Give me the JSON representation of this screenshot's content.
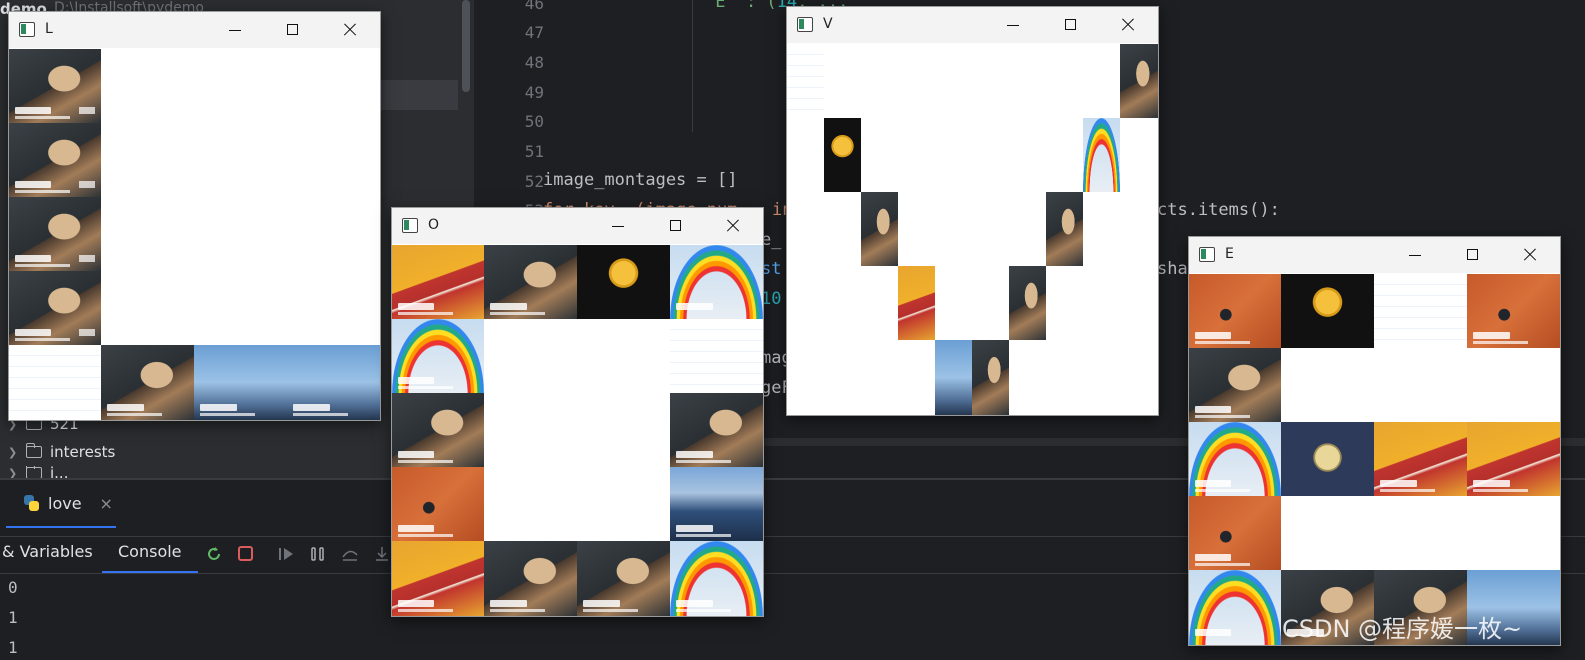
{
  "ide": {
    "project_title": "demo",
    "project_path": "D:\\Installsoft\\pydemo",
    "tree": [
      {
        "label": "521"
      },
      {
        "label": "interests"
      },
      {
        "label": "i..."
      }
    ],
    "line_numbers": [
      "46",
      "47",
      "48",
      "49",
      "50",
      "51",
      "52",
      "53"
    ],
    "code": {
      "line46_str": "'E'",
      "line46_num": "14",
      "line52": "image_montages = []",
      "line53_start": "for key, (image_num",
      "line53_mid": "in",
      "line53_end": "cts.items():",
      "frag1": "e_",
      "frag2": "st",
      "frag2_end": "shap",
      "frag3": "10",
      "frag4": "mag",
      "frag5": "geF"
    },
    "run": {
      "tab_label": "love",
      "tabs": [
        "& Variables",
        "Console"
      ],
      "active_tab": "Console",
      "output": [
        "0",
        "1",
        "1"
      ]
    }
  },
  "windows": [
    {
      "id": "L",
      "title": "L"
    },
    {
      "id": "O",
      "title": "O"
    },
    {
      "id": "V",
      "title": "V"
    },
    {
      "id": "E",
      "title": "E"
    }
  ],
  "watermark": "CSDN @程序媛一枚~"
}
